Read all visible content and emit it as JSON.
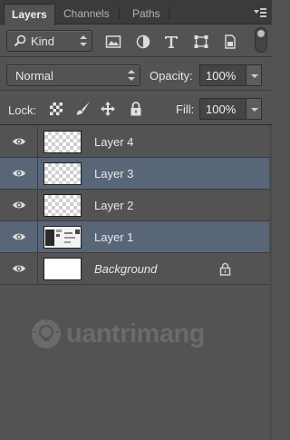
{
  "tabs": [
    {
      "label": "Layers",
      "active": true
    },
    {
      "label": "Channels",
      "active": false
    },
    {
      "label": "Paths",
      "active": false
    }
  ],
  "filter": {
    "kind_label": "Kind",
    "icons": [
      "pixel-layer-filter-icon",
      "adjustment-layer-filter-icon",
      "type-layer-filter-icon",
      "shape-layer-filter-icon",
      "smart-object-filter-icon"
    ]
  },
  "blend": {
    "mode": "Normal",
    "opacity_label": "Opacity:",
    "opacity_value": "100%"
  },
  "lock": {
    "label": "Lock:",
    "icons": [
      "lock-transparent-pixels-icon",
      "lock-image-pixels-icon",
      "lock-position-icon",
      "lock-all-icon"
    ],
    "fill_label": "Fill:",
    "fill_value": "100%"
  },
  "layers": [
    {
      "name": "Layer 4",
      "selected": false,
      "thumb": "transparent"
    },
    {
      "name": "Layer 3",
      "selected": true,
      "thumb": "transparent"
    },
    {
      "name": "Layer 2",
      "selected": false,
      "thumb": "transparent"
    },
    {
      "name": "Layer 1",
      "selected": true,
      "thumb": "image"
    },
    {
      "name": "Background",
      "selected": false,
      "thumb": "white",
      "locked": true
    }
  ],
  "watermark": {
    "text": "uantrimang"
  },
  "colors": {
    "panel_bg": "#535353",
    "selected_row": "#596678",
    "tabbar_bg": "#3b3b3b"
  }
}
